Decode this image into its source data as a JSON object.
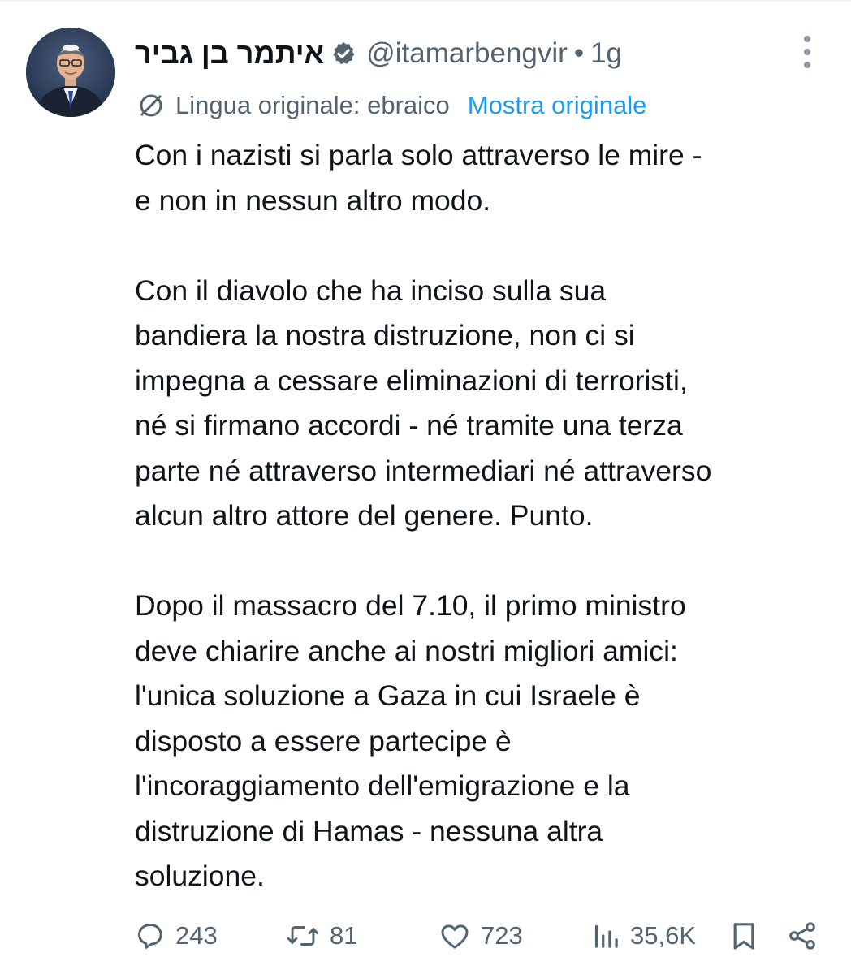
{
  "post": {
    "display_name": "איתמר בן גביר",
    "handle": "@itamarbengvir",
    "separator": "•",
    "time": "1g",
    "translation_label": "Lingua originale: ebraico",
    "show_original": "Mostra originale",
    "paragraphs": [
      [
        "Con i nazisti si parla solo attraverso le mire -",
        "e non in nessun altro modo."
      ],
      [
        "Con il diavolo che ha inciso sulla sua",
        "bandiera la nostra distruzione, non ci si",
        "impegna a cessare eliminazioni di terroristi,",
        "né si firmano accordi - né tramite una terza",
        "parte né attraverso intermediari né attraverso",
        "alcun altro attore del genere. Punto."
      ],
      [
        "Dopo il massacro del 7.10, il primo ministro",
        "deve chiarire anche ai nostri migliori amici:",
        "l'unica soluzione a Gaza in cui Israele è",
        "disposto a essere partecipe è",
        "l'incoraggiamento dell'emigrazione e la",
        "distruzione di Hamas - nessuna altra",
        "soluzione."
      ]
    ]
  },
  "actions": {
    "replies": "243",
    "reposts": "81",
    "likes": "723",
    "views": "35,6K"
  },
  "icons": {
    "verified": "verified-badge-icon",
    "more": "more-vertical-icon",
    "translate": "translate-icon",
    "reply": "reply-icon",
    "repost": "repost-icon",
    "like": "heart-icon",
    "views": "views-icon",
    "bookmark": "bookmark-icon",
    "share": "share-icon"
  },
  "colors": {
    "text": "#0f1419",
    "secondary": "#536471",
    "link": "#1d9bf0"
  }
}
